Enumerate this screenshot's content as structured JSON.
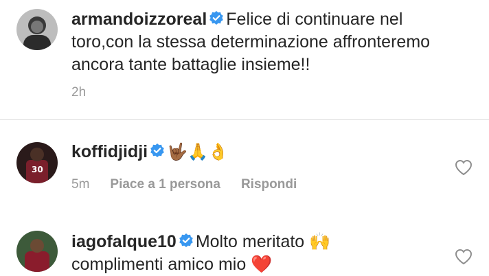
{
  "caption": {
    "username": "armandoizzoreal",
    "text": "Felice di continuare nel toro,con la stessa determinazione affronteremo ancora tante battaglie insieme!!",
    "line1": "Felice di continuare nel",
    "line2": "toro,con la stessa determinazione affronteremo",
    "line3": "ancora tante battaglie insieme!!",
    "time": "2h"
  },
  "comments": [
    {
      "username": "koffidjidji",
      "text": "🤟🏾🙏👌",
      "time": "5m",
      "likes": "Piace a 1 persona",
      "reply": "Rispondi"
    },
    {
      "username": "iagofalque10",
      "text": "Molto meritato 🙌 complimenti amico mio ❤️",
      "line1": "Molto meritato 🙌",
      "line2": "complimenti amico mio ❤️"
    }
  ],
  "colors": {
    "verified": "#3897f0",
    "meta": "#999999",
    "text": "#262626"
  }
}
